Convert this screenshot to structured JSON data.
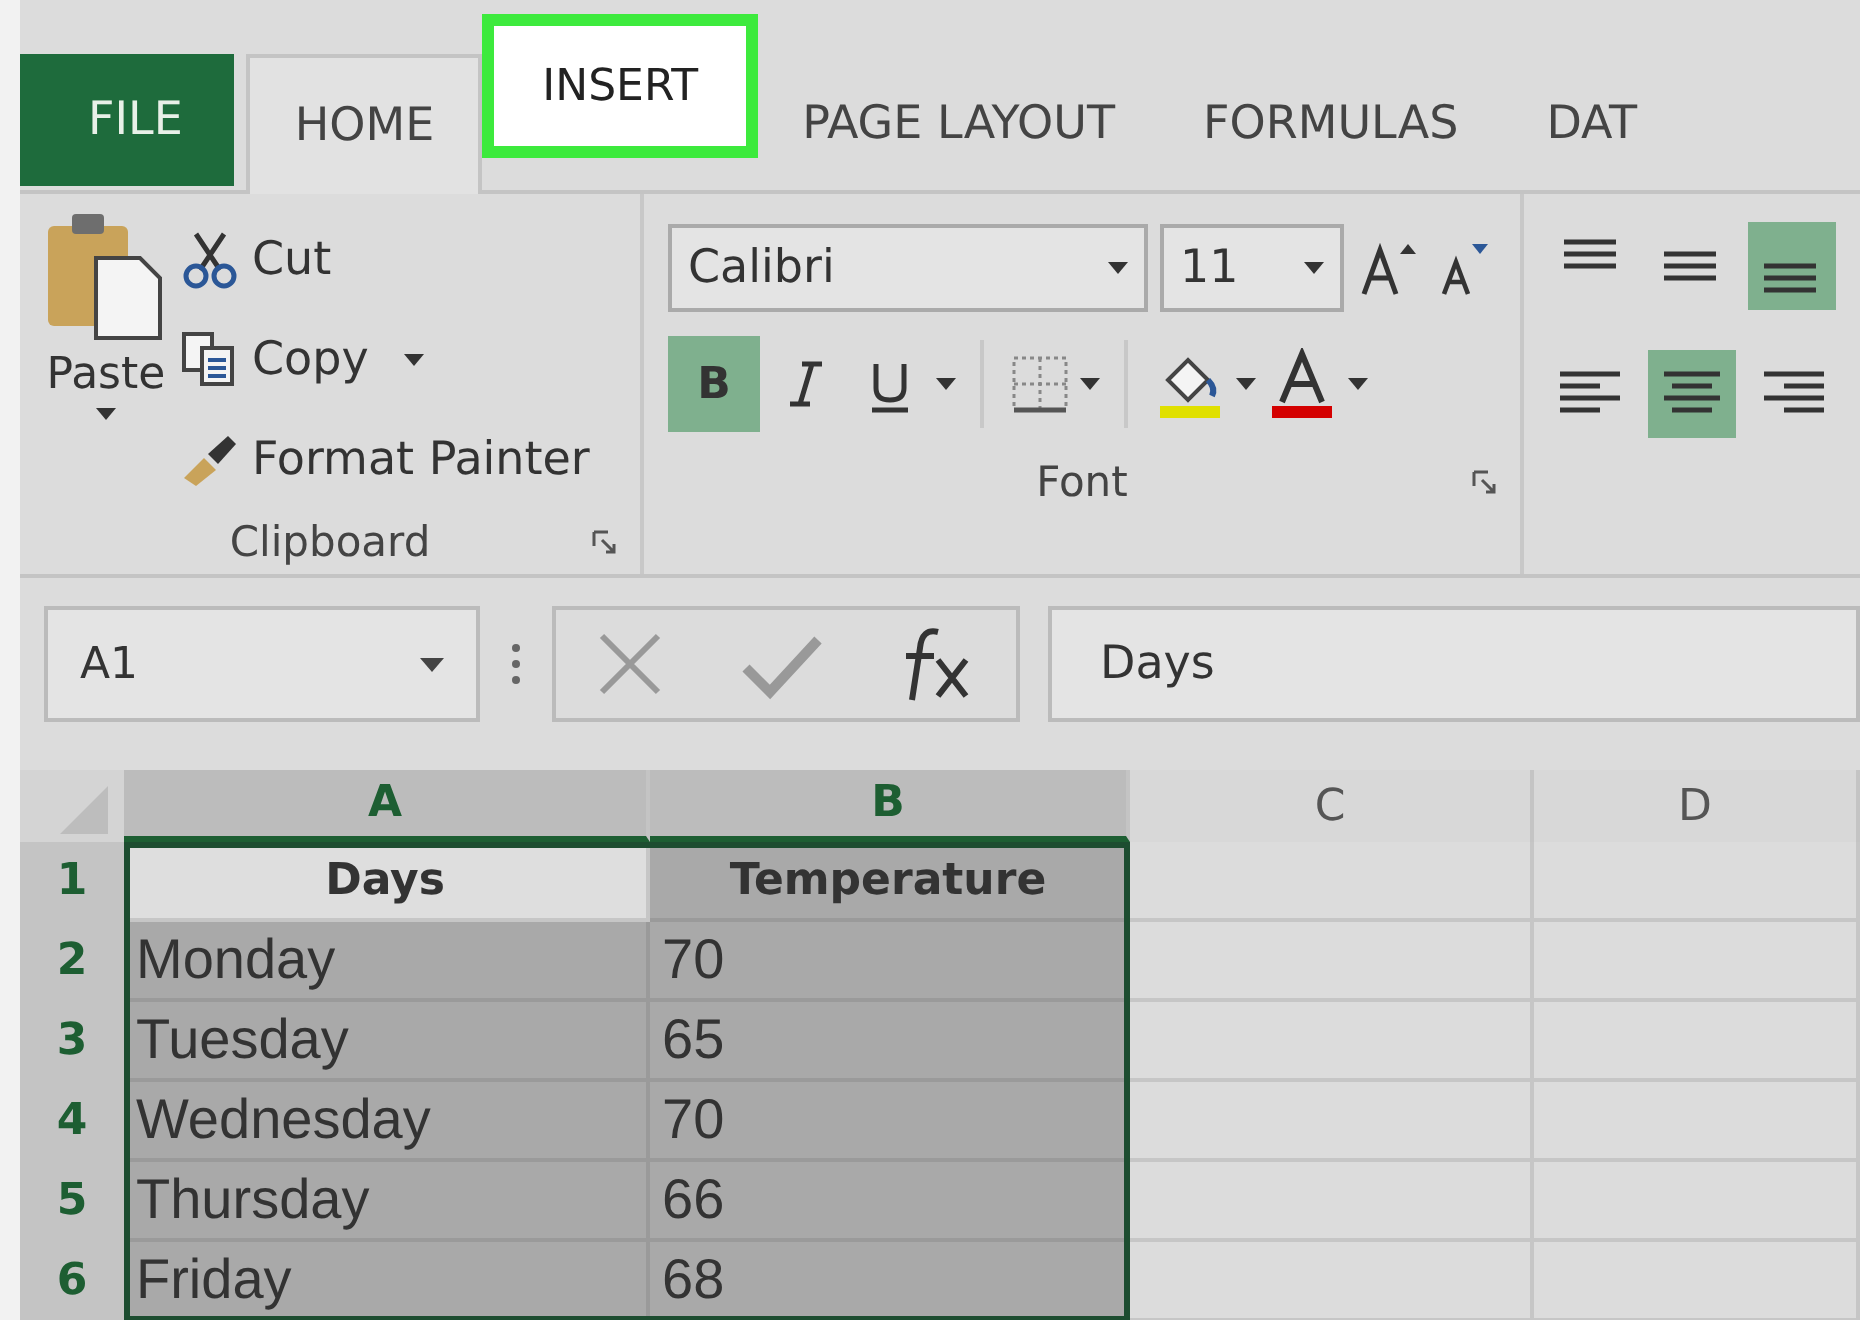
{
  "ribbon_tabs": [
    {
      "label": "FILE",
      "kind": "file",
      "selected": false,
      "highlighted": false
    },
    {
      "label": "HOME",
      "kind": "tab",
      "selected": true,
      "highlighted": false
    },
    {
      "label": "INSERT",
      "kind": "tab",
      "selected": false,
      "highlighted": true
    },
    {
      "label": "PAGE LAYOUT",
      "kind": "tab",
      "selected": false,
      "highlighted": false
    },
    {
      "label": "FORMULAS",
      "kind": "tab",
      "selected": false,
      "highlighted": false
    },
    {
      "label": "DAT",
      "kind": "tab",
      "selected": false,
      "highlighted": false
    }
  ],
  "clipboard": {
    "paste": "Paste",
    "title": "Clipboard",
    "commands": [
      {
        "label": "Cut",
        "kind": "cut",
        "dropdown": false
      },
      {
        "label": "Copy",
        "kind": "copy",
        "dropdown": true
      },
      {
        "label": "Format Painter",
        "kind": "brush",
        "dropdown": false
      }
    ]
  },
  "font": {
    "name": "Calibri",
    "size": "11",
    "title": "Font",
    "bold_label": "B",
    "bold": true,
    "italic": false,
    "underline": false
  },
  "alignment_buttons": [
    {
      "kind": "top",
      "selected": false
    },
    {
      "kind": "middle",
      "selected": false
    },
    {
      "kind": "bottom",
      "selected": true
    },
    {
      "kind": "left",
      "selected": false
    },
    {
      "kind": "center",
      "selected": true
    },
    {
      "kind": "right",
      "selected": false
    }
  ],
  "formula_bar": {
    "name_box": "A1",
    "value": "Days"
  },
  "sheet": {
    "columns": [
      {
        "label": "A",
        "selected": true
      },
      {
        "label": "B",
        "selected": true
      },
      {
        "label": "C",
        "selected": false
      },
      {
        "label": "D",
        "selected": false
      }
    ],
    "rows": [
      {
        "number": "1",
        "selected": true,
        "kind": "header",
        "cells": [
          "Days",
          "Temperature"
        ]
      },
      {
        "number": "2",
        "selected": true,
        "kind": "data",
        "cells": [
          "Monday",
          "70"
        ]
      },
      {
        "number": "3",
        "selected": true,
        "kind": "data",
        "cells": [
          "Tuesday",
          "65"
        ]
      },
      {
        "number": "4",
        "selected": true,
        "kind": "data",
        "cells": [
          "Wednesday",
          "70"
        ]
      },
      {
        "number": "5",
        "selected": true,
        "kind": "data",
        "cells": [
          "Thursday",
          "66"
        ]
      },
      {
        "number": "6",
        "selected": true,
        "kind": "data",
        "cells": [
          "Friday",
          "68"
        ]
      }
    ]
  }
}
